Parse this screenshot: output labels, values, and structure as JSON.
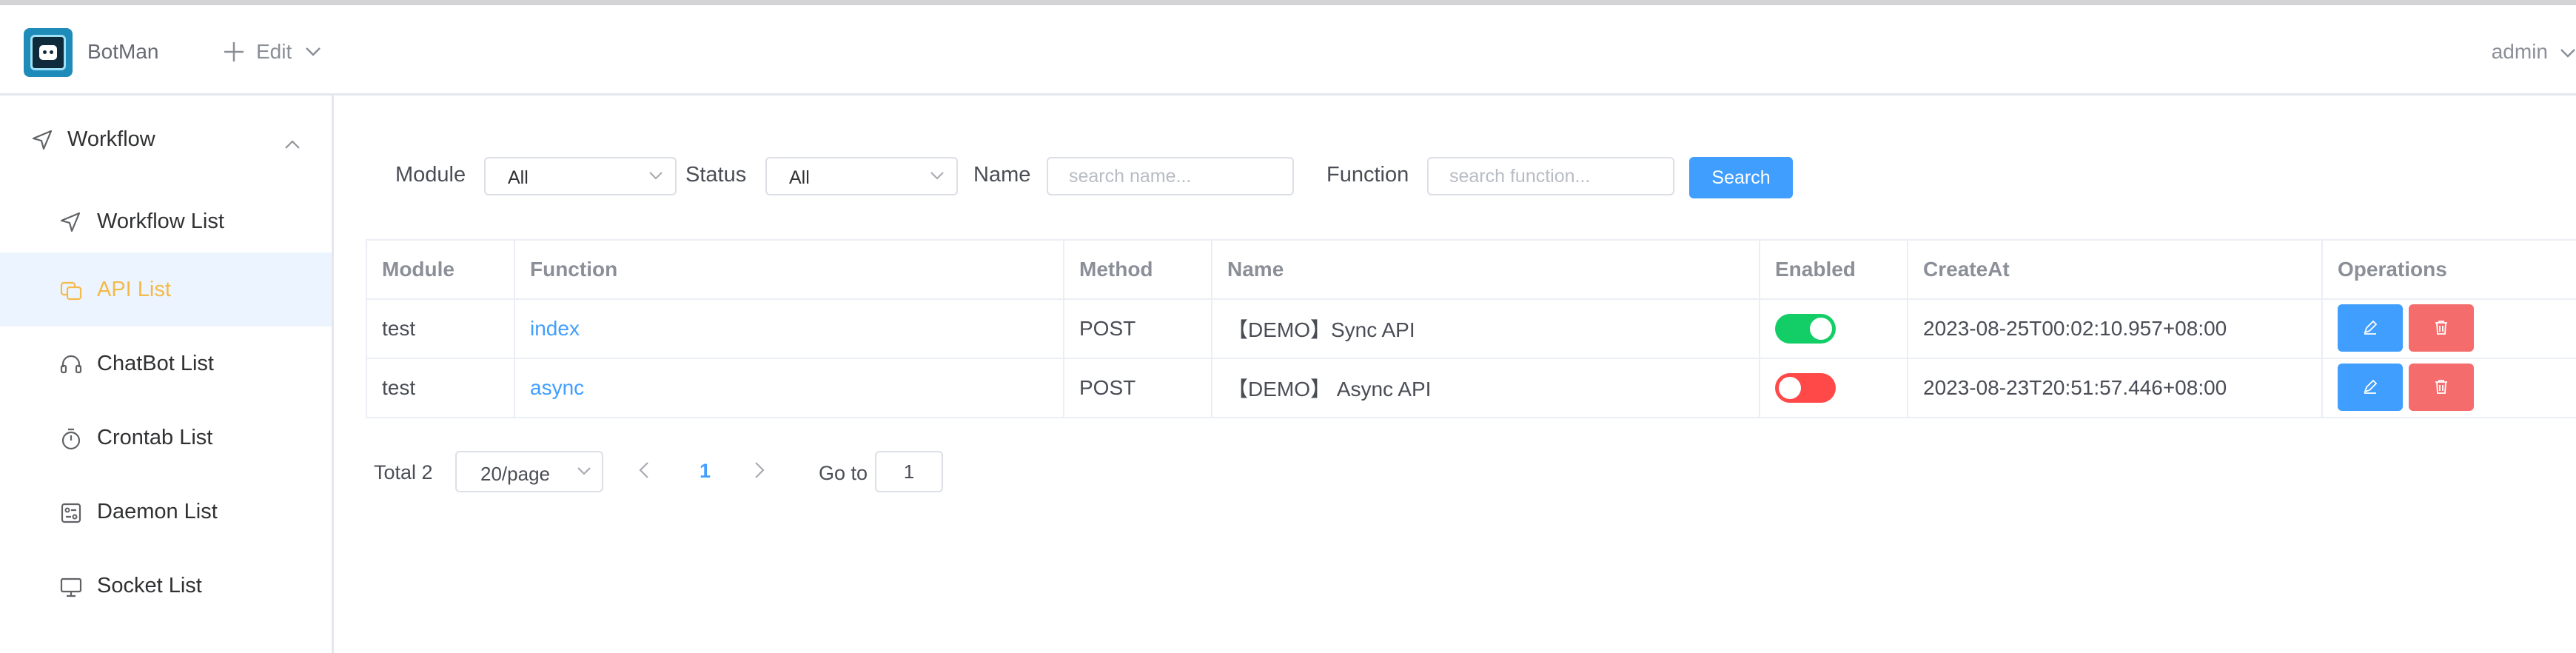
{
  "app": {
    "name": "BotMan"
  },
  "header": {
    "edit_label": "Edit",
    "user_name": "admin"
  },
  "sidebar": {
    "group_label": "Workflow",
    "items": [
      {
        "label": "Workflow List",
        "icon": "send-icon",
        "active": false
      },
      {
        "label": "API List",
        "icon": "api-icon",
        "active": true
      },
      {
        "label": "ChatBot List",
        "icon": "headset-icon",
        "active": false
      },
      {
        "label": "Crontab List",
        "icon": "timer-icon",
        "active": false
      },
      {
        "label": "Daemon List",
        "icon": "daemon-icon",
        "active": false
      },
      {
        "label": "Socket List",
        "icon": "monitor-icon",
        "active": false
      }
    ]
  },
  "filters": {
    "module_label": "Module",
    "module_value": "All",
    "status_label": "Status",
    "status_value": "All",
    "name_label": "Name",
    "name_placeholder": "search name...",
    "function_label": "Function",
    "function_placeholder": "search function...",
    "search_button": "Search"
  },
  "table": {
    "columns": [
      "Module",
      "Function",
      "Method",
      "Name",
      "Enabled",
      "CreateAt",
      "Operations"
    ],
    "rows": [
      {
        "module": "test",
        "function": "index",
        "method": "POST",
        "name": "【DEMO】Sync API",
        "enabled": true,
        "create_at": "2023-08-25T00:02:10.957+08:00"
      },
      {
        "module": "test",
        "function": "async",
        "method": "POST",
        "name": "【DEMO】 Async API",
        "enabled": false,
        "create_at": "2023-08-23T20:51:57.446+08:00"
      }
    ]
  },
  "pagination": {
    "total_label": "Total 2",
    "page_size": "20/page",
    "current_page": "1",
    "goto_label": "Go to",
    "goto_value": "1"
  },
  "colors": {
    "primary": "#409eff",
    "danger": "#f56c6c",
    "switch_on": "#13ce66",
    "switch_off": "#ff4949",
    "active_menu_text": "#f5b94a",
    "active_menu_bg": "#ecf5ff"
  }
}
